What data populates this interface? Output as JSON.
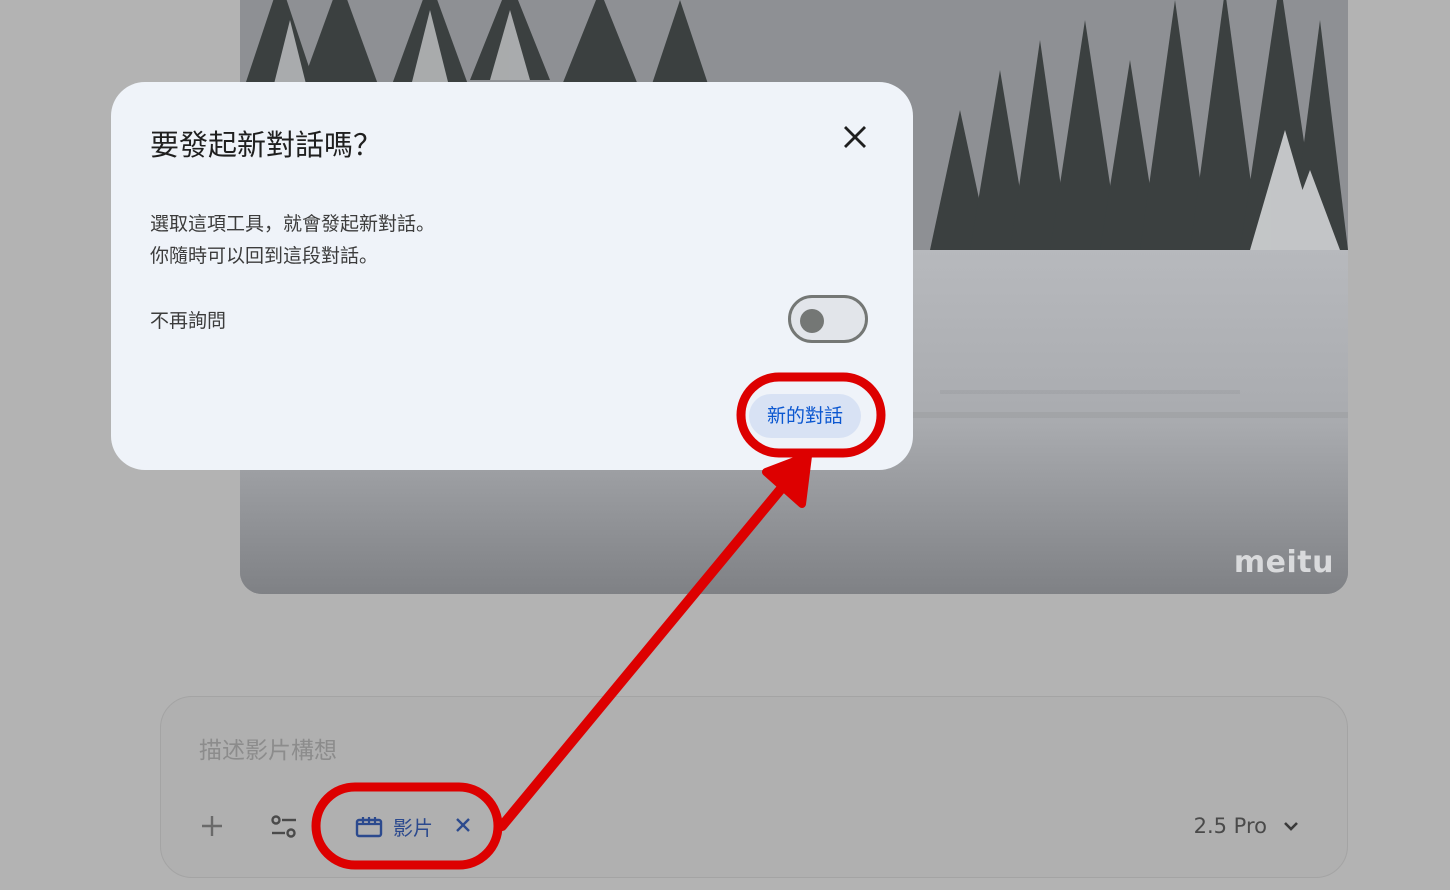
{
  "background": {
    "watermark": "meitu"
  },
  "dialog": {
    "title": "要發起新對話嗎？",
    "close_icon": "close-icon",
    "body_line1": "選取這項工具，就會發起新對話。",
    "body_line2": "你隨時可以回到這段對話。",
    "dont_ask_label": "不再詢問",
    "dont_ask_toggle": {
      "state": "off"
    },
    "primary_button": "新的對話"
  },
  "composer": {
    "placeholder": "描述影片構想",
    "add_icon": "plus-icon",
    "tools_icon": "tune-icon",
    "chip": {
      "icon": "clapperboard-icon",
      "label": "影片",
      "remove_icon": "close-icon"
    },
    "model": "2.5 Pro",
    "model_dropdown_icon": "chevron-down-icon"
  },
  "colors": {
    "annotation": "#dd0000",
    "accent": "#0b57d0",
    "dialog_bg": "#eff3f9"
  }
}
